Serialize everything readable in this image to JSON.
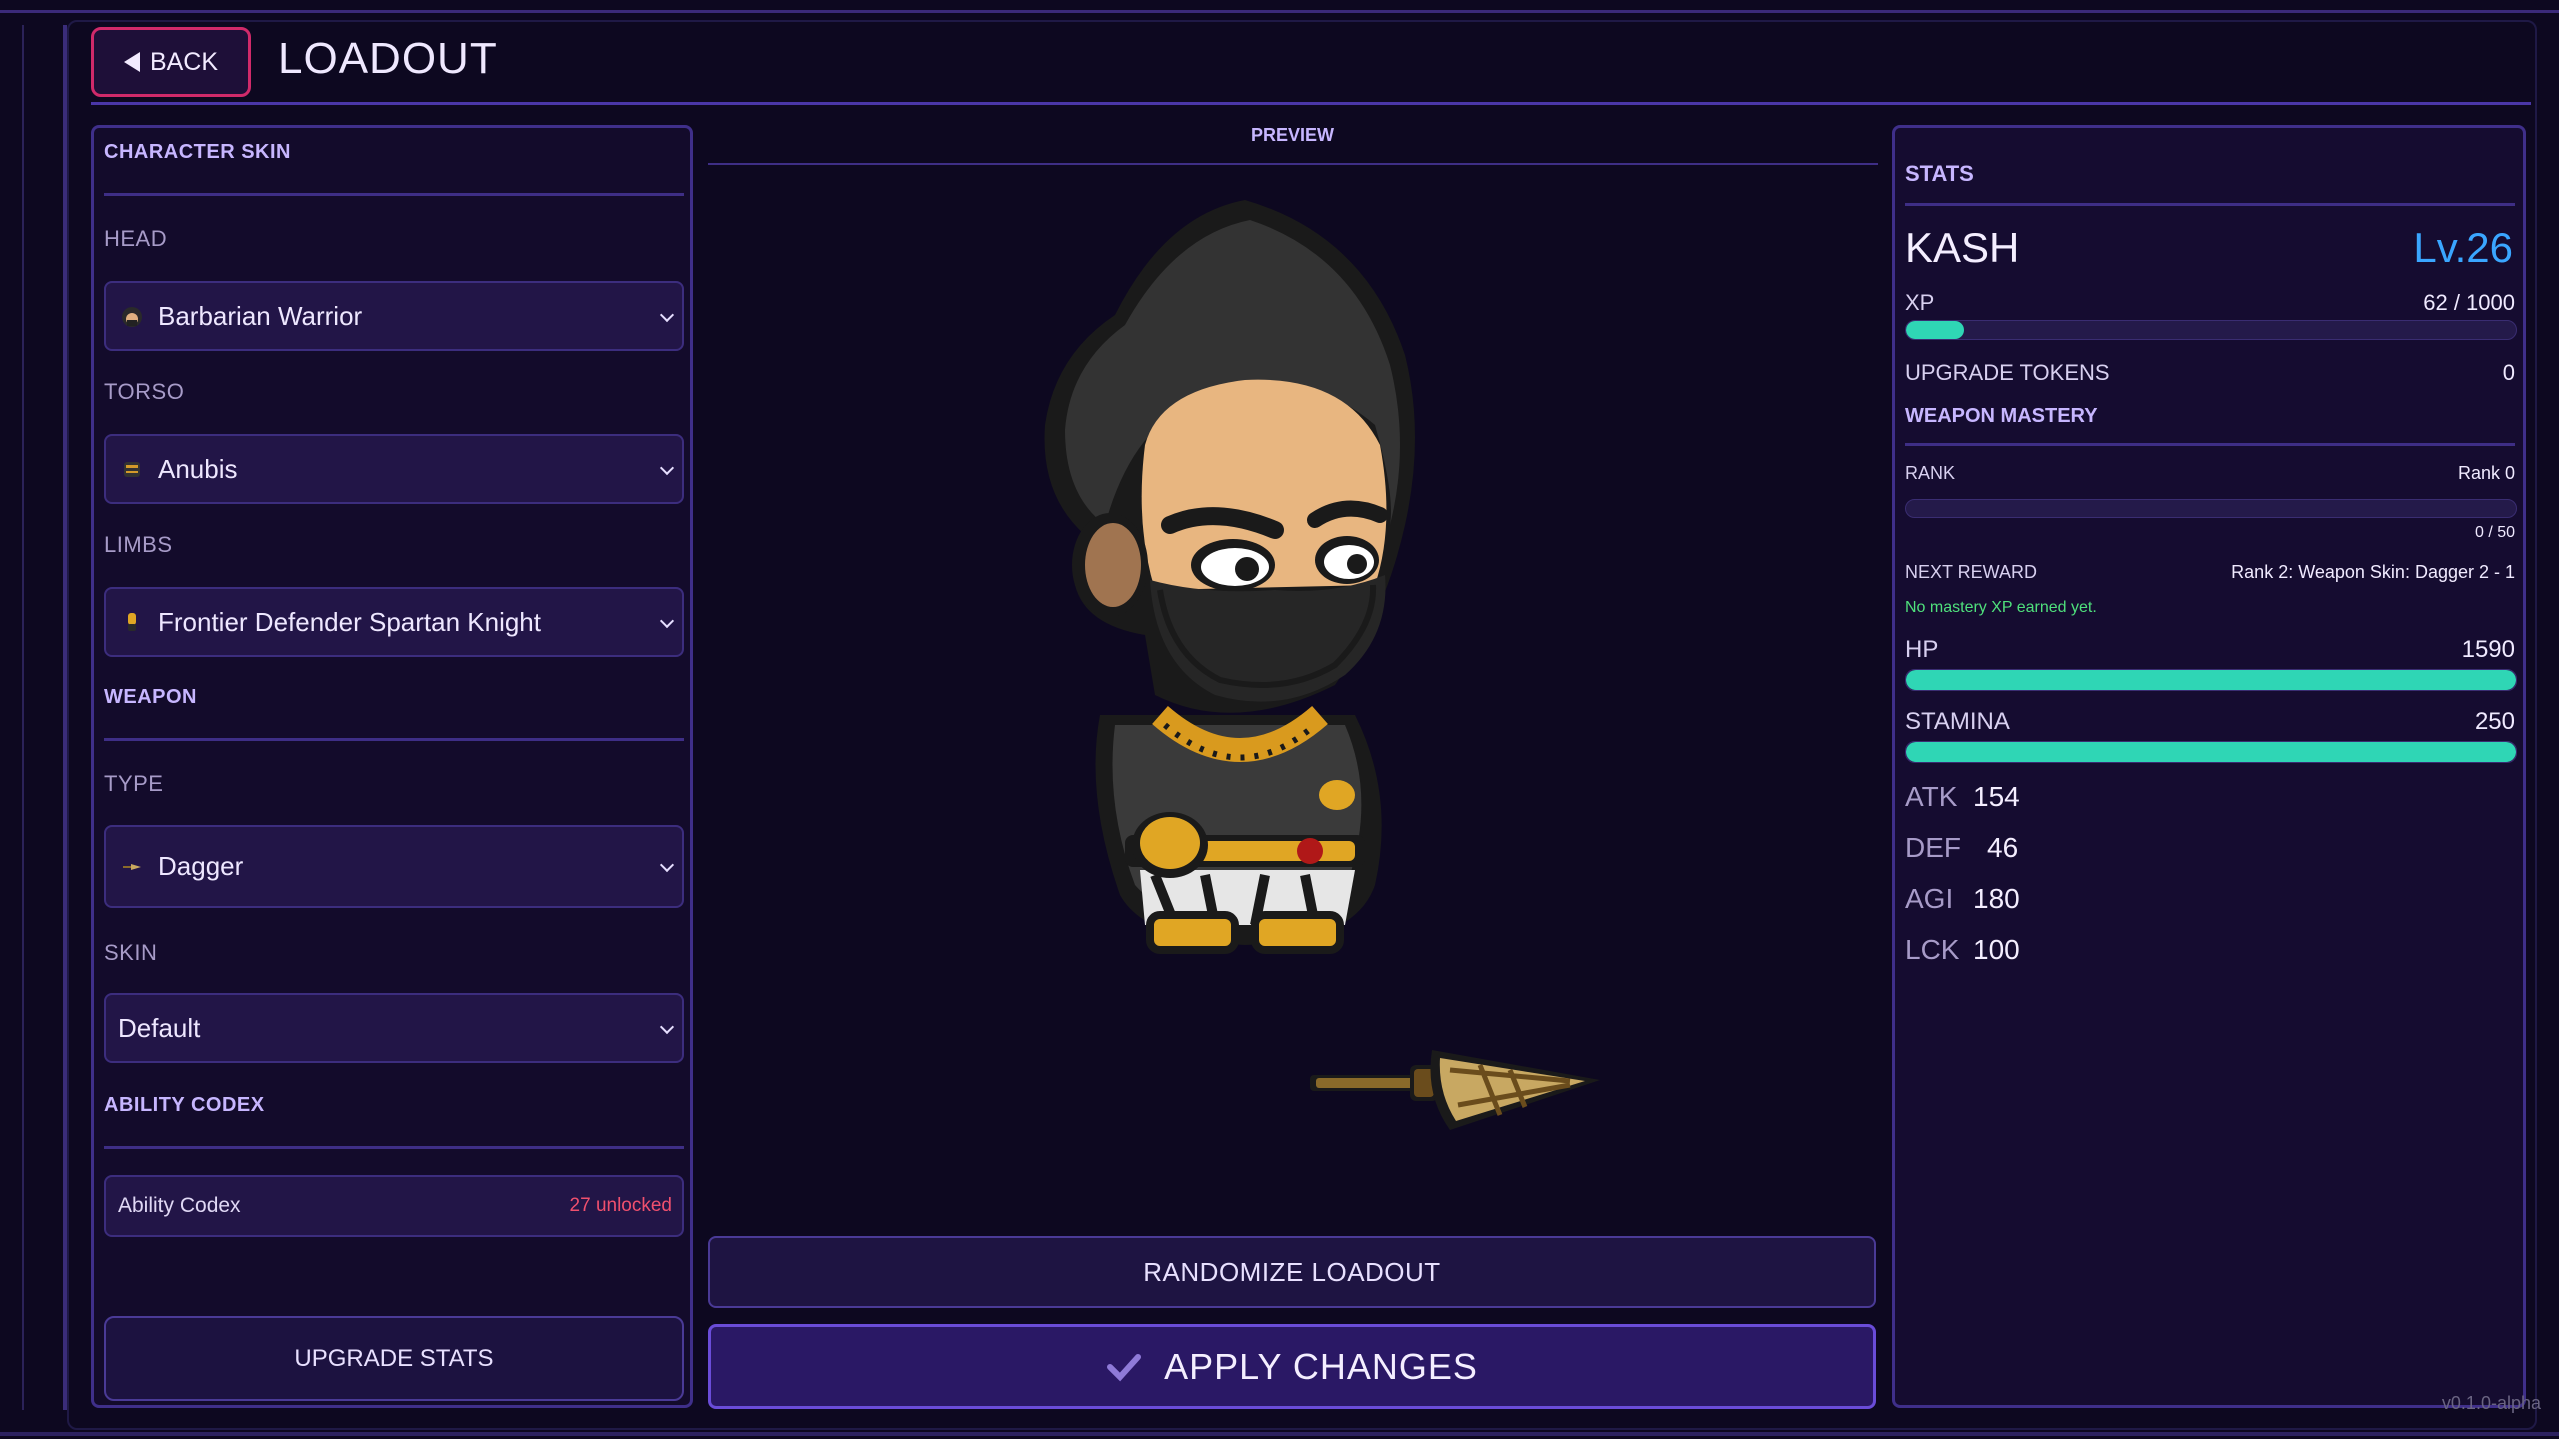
{
  "header": {
    "back_label": "BACK",
    "title": "LOADOUT"
  },
  "left": {
    "character_skin_title": "CHARACTER SKIN",
    "head": {
      "label": "HEAD",
      "value": "Barbarian Warrior"
    },
    "torso": {
      "label": "TORSO",
      "value": "Anubis"
    },
    "limbs": {
      "label": "LIMBS",
      "value": "Frontier Defender Spartan Knight"
    },
    "weapon_title": "WEAPON",
    "type": {
      "label": "TYPE",
      "value": "Dagger"
    },
    "skin": {
      "label": "SKIN",
      "value": "Default"
    },
    "codex_title": "ABILITY CODEX",
    "codex": {
      "label": "Ability Codex",
      "count": "27 unlocked"
    },
    "upgrade_label": "UPGRADE STATS"
  },
  "preview": {
    "label": "PREVIEW",
    "randomize_label": "RANDOMIZE LOADOUT",
    "apply_label": "APPLY CHANGES"
  },
  "stats": {
    "title": "STATS",
    "name": "KASH",
    "level": "Lv.26",
    "xp_label": "XP",
    "xp_value": "62 / 1000",
    "xp_fraction": 0.062,
    "tokens_label": "UPGRADE TOKENS",
    "tokens_value": "0",
    "mastery_title": "WEAPON MASTERY",
    "rank_label": "RANK",
    "rank_value": "Rank 0",
    "rank_progress": "0 / 50",
    "rank_fraction": 0.0,
    "next_reward_label": "NEXT REWARD",
    "next_reward_value": "Rank 2: Weapon Skin: Dagger 2 - 1",
    "mastery_note": "No mastery XP earned yet.",
    "hp_label": "HP",
    "hp_value": "1590",
    "hp_fraction": 1.0,
    "stamina_label": "STAMINA",
    "stamina_value": "250",
    "stamina_fraction": 1.0,
    "atk_label": "ATK",
    "atk_value": "154",
    "def_label": "DEF",
    "def_value": "46",
    "agi_label": "AGI",
    "agi_value": "180",
    "lck_label": "LCK",
    "lck_value": "100"
  },
  "version": "v0.1.0-alpha",
  "colors": {
    "accent": "#6a4cd8",
    "bar_fill": "#2fd6b5",
    "level": "#3aa6ff",
    "danger": "#d02a6a",
    "codex_count": "#f0506e",
    "note": "#4fe07c"
  },
  "icons": {
    "back": "back-triangle-icon",
    "apply": "checkmark-icon",
    "select": "chevron-down-icon"
  }
}
